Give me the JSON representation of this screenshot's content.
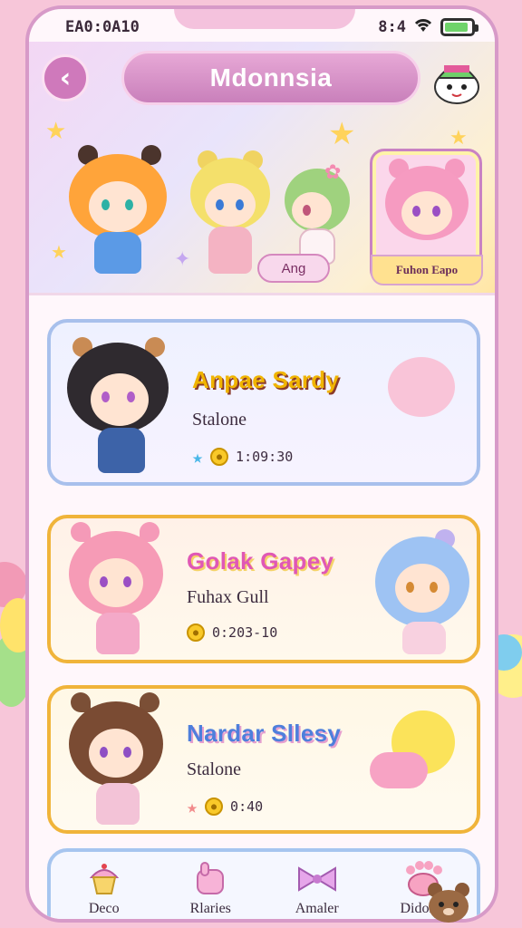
{
  "status_bar": {
    "time_left": "EA0:0A10",
    "time_right": "8:4",
    "battery_level": 0.9
  },
  "header": {
    "title": "Mdonnsia",
    "tag_pill": "Ang",
    "featured_label": "Fuhon Eapo"
  },
  "cards": [
    {
      "name": "Anpae Sardy",
      "subtitle": "Stalone",
      "stat": "1:09:30",
      "accent": "#f0b400",
      "border": "#a8c0ec"
    },
    {
      "name": "Golak Gapey",
      "subtitle": "Fuhax Gull",
      "stat": "0:203-10",
      "accent": "#e058b5",
      "border": "#f0b43a"
    },
    {
      "name": "Nardar Sllesy",
      "subtitle": "Stalone",
      "stat": "0:40",
      "accent": "#4e7fdc",
      "border": "#f0b43a"
    }
  ],
  "bottom_nav": [
    {
      "label": "Deco",
      "icon": "cupcake-icon"
    },
    {
      "label": "Rlaries",
      "icon": "hand-icon"
    },
    {
      "label": "Amaler",
      "icon": "bow-icon"
    },
    {
      "label": "Didome",
      "icon": "paw-icon"
    }
  ]
}
